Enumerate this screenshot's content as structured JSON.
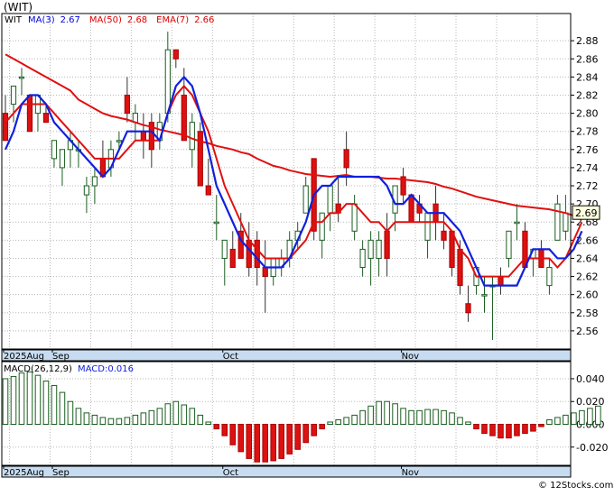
{
  "chart_data": [
    {
      "type": "candlestick",
      "symbol": "(WIT)",
      "legend": {
        "ticker": "WIT",
        "items": [
          {
            "label": "MA(3)",
            "value": "2.67",
            "color": "#0000dd"
          },
          {
            "label": "MA(50)",
            "value": "2.68",
            "color": "#dd0000"
          },
          {
            "label": "EMA(7)",
            "value": "2.66",
            "color": "#dd0000"
          }
        ]
      },
      "ylim": [
        2.54,
        2.91
      ],
      "y_ticks": [
        "2.88",
        "2.86",
        "2.84",
        "2.82",
        "2.80",
        "2.78",
        "2.76",
        "2.74",
        "2.72",
        "2.70",
        "2.68",
        "2.66",
        "2.64",
        "2.62",
        "2.60",
        "2.58",
        "2.56"
      ],
      "x_labels": [
        {
          "index": 0,
          "label": "2025Aug"
        },
        {
          "index": 6,
          "label": "Sep"
        },
        {
          "index": 27,
          "label": "Oct"
        },
        {
          "index": 49,
          "label": "Nov"
        }
      ],
      "last_price": "2.69",
      "candles": [
        {
          "o": 2.8,
          "h": 2.82,
          "l": 2.77,
          "c": 2.77
        },
        {
          "o": 2.81,
          "h": 2.83,
          "l": 2.79,
          "c": 2.83
        },
        {
          "o": 2.84,
          "h": 2.85,
          "l": 2.82,
          "c": 2.84
        },
        {
          "o": 2.82,
          "h": 2.82,
          "l": 2.78,
          "c": 2.78
        },
        {
          "o": 2.8,
          "h": 2.82,
          "l": 2.78,
          "c": 2.82
        },
        {
          "o": 2.8,
          "h": 2.81,
          "l": 2.79,
          "c": 2.79
        },
        {
          "o": 2.75,
          "h": 2.77,
          "l": 2.74,
          "c": 2.77
        },
        {
          "o": 2.74,
          "h": 2.76,
          "l": 2.72,
          "c": 2.76
        },
        {
          "o": 2.76,
          "h": 2.78,
          "l": 2.74,
          "c": 2.77
        },
        {
          "o": 2.76,
          "h": 2.77,
          "l": 2.74,
          "c": 2.76
        },
        {
          "o": 2.71,
          "h": 2.73,
          "l": 2.69,
          "c": 2.72
        },
        {
          "o": 2.72,
          "h": 2.74,
          "l": 2.7,
          "c": 2.73
        },
        {
          "o": 2.75,
          "h": 2.77,
          "l": 2.73,
          "c": 2.73
        },
        {
          "o": 2.74,
          "h": 2.77,
          "l": 2.73,
          "c": 2.76
        },
        {
          "o": 2.77,
          "h": 2.78,
          "l": 2.76,
          "c": 2.77
        },
        {
          "o": 2.82,
          "h": 2.84,
          "l": 2.79,
          "c": 2.8
        },
        {
          "o": 2.79,
          "h": 2.81,
          "l": 2.77,
          "c": 2.8
        },
        {
          "o": 2.78,
          "h": 2.8,
          "l": 2.75,
          "c": 2.77
        },
        {
          "o": 2.79,
          "h": 2.8,
          "l": 2.74,
          "c": 2.76
        },
        {
          "o": 2.77,
          "h": 2.8,
          "l": 2.76,
          "c": 2.79
        },
        {
          "o": 2.8,
          "h": 2.89,
          "l": 2.79,
          "c": 2.87
        },
        {
          "o": 2.87,
          "h": 2.87,
          "l": 2.85,
          "c": 2.86
        },
        {
          "o": 2.82,
          "h": 2.85,
          "l": 2.77,
          "c": 2.77
        },
        {
          "o": 2.76,
          "h": 2.8,
          "l": 2.74,
          "c": 2.79
        },
        {
          "o": 2.78,
          "h": 2.79,
          "l": 2.72,
          "c": 2.72
        },
        {
          "o": 2.72,
          "h": 2.75,
          "l": 2.71,
          "c": 2.71
        },
        {
          "o": 2.68,
          "h": 2.71,
          "l": 2.66,
          "c": 2.68
        },
        {
          "o": 2.64,
          "h": 2.66,
          "l": 2.61,
          "c": 2.66
        },
        {
          "o": 2.65,
          "h": 2.67,
          "l": 2.63,
          "c": 2.63
        },
        {
          "o": 2.67,
          "h": 2.69,
          "l": 2.64,
          "c": 2.64
        },
        {
          "o": 2.66,
          "h": 2.68,
          "l": 2.62,
          "c": 2.63
        },
        {
          "o": 2.66,
          "h": 2.67,
          "l": 2.61,
          "c": 2.63
        },
        {
          "o": 2.63,
          "h": 2.66,
          "l": 2.58,
          "c": 2.62
        },
        {
          "o": 2.62,
          "h": 2.64,
          "l": 2.61,
          "c": 2.64
        },
        {
          "o": 2.63,
          "h": 2.65,
          "l": 2.62,
          "c": 2.64
        },
        {
          "o": 2.64,
          "h": 2.67,
          "l": 2.63,
          "c": 2.66
        },
        {
          "o": 2.66,
          "h": 2.68,
          "l": 2.65,
          "c": 2.67
        },
        {
          "o": 2.69,
          "h": 2.73,
          "l": 2.69,
          "c": 2.72
        },
        {
          "o": 2.75,
          "h": 2.75,
          "l": 2.66,
          "c": 2.67
        },
        {
          "o": 2.66,
          "h": 2.68,
          "l": 2.64,
          "c": 2.69
        },
        {
          "o": 2.69,
          "h": 2.72,
          "l": 2.67,
          "c": 2.72
        },
        {
          "o": 2.7,
          "h": 2.73,
          "l": 2.68,
          "c": 2.69
        },
        {
          "o": 2.76,
          "h": 2.78,
          "l": 2.72,
          "c": 2.74
        },
        {
          "o": 2.67,
          "h": 2.71,
          "l": 2.66,
          "c": 2.7
        },
        {
          "o": 2.63,
          "h": 2.66,
          "l": 2.62,
          "c": 2.65
        },
        {
          "o": 2.64,
          "h": 2.67,
          "l": 2.61,
          "c": 2.66
        },
        {
          "o": 2.64,
          "h": 2.67,
          "l": 2.62,
          "c": 2.66
        },
        {
          "o": 2.67,
          "h": 2.69,
          "l": 2.62,
          "c": 2.64
        },
        {
          "o": 2.69,
          "h": 2.72,
          "l": 2.67,
          "c": 2.72
        },
        {
          "o": 2.73,
          "h": 2.74,
          "l": 2.7,
          "c": 2.71
        },
        {
          "o": 2.71,
          "h": 2.71,
          "l": 2.68,
          "c": 2.68
        },
        {
          "o": 2.7,
          "h": 2.71,
          "l": 2.68,
          "c": 2.69
        },
        {
          "o": 2.66,
          "h": 2.69,
          "l": 2.64,
          "c": 2.69
        },
        {
          "o": 2.7,
          "h": 2.72,
          "l": 2.66,
          "c": 2.68
        },
        {
          "o": 2.67,
          "h": 2.69,
          "l": 2.65,
          "c": 2.66
        },
        {
          "o": 2.67,
          "h": 2.67,
          "l": 2.62,
          "c": 2.63
        },
        {
          "o": 2.65,
          "h": 2.66,
          "l": 2.6,
          "c": 2.61
        },
        {
          "o": 2.59,
          "h": 2.61,
          "l": 2.57,
          "c": 2.58
        },
        {
          "o": 2.61,
          "h": 2.63,
          "l": 2.6,
          "c": 2.63
        },
        {
          "o": 2.6,
          "h": 2.62,
          "l": 2.58,
          "c": 2.6
        },
        {
          "o": 2.61,
          "h": 2.62,
          "l": 2.55,
          "c": 2.61
        },
        {
          "o": 2.62,
          "h": 2.63,
          "l": 2.6,
          "c": 2.61
        },
        {
          "o": 2.64,
          "h": 2.67,
          "l": 2.63,
          "c": 2.67
        },
        {
          "o": 2.68,
          "h": 2.7,
          "l": 2.66,
          "c": 2.68
        },
        {
          "o": 2.67,
          "h": 2.68,
          "l": 2.63,
          "c": 2.63
        },
        {
          "o": 2.64,
          "h": 2.65,
          "l": 2.62,
          "c": 2.65
        },
        {
          "o": 2.65,
          "h": 2.66,
          "l": 2.63,
          "c": 2.63
        },
        {
          "o": 2.61,
          "h": 2.64,
          "l": 2.6,
          "c": 2.63
        },
        {
          "o": 2.66,
          "h": 2.71,
          "l": 2.66,
          "c": 2.7
        },
        {
          "o": 2.67,
          "h": 2.71,
          "l": 2.66,
          "c": 2.69
        }
      ],
      "ma3": [
        2.76,
        2.78,
        2.81,
        2.82,
        2.82,
        2.81,
        2.79,
        2.78,
        2.77,
        2.76,
        2.75,
        2.74,
        2.73,
        2.74,
        2.76,
        2.78,
        2.78,
        2.78,
        2.78,
        2.77,
        2.8,
        2.83,
        2.84,
        2.83,
        2.8,
        2.76,
        2.72,
        2.7,
        2.68,
        2.66,
        2.65,
        2.64,
        2.63,
        2.63,
        2.63,
        2.64,
        2.66,
        2.68,
        2.71,
        2.72,
        2.72,
        2.73,
        2.73,
        2.73,
        2.73,
        2.73,
        2.73,
        2.72,
        2.7,
        2.7,
        2.71,
        2.7,
        2.69,
        2.69,
        2.69,
        2.68,
        2.67,
        2.65,
        2.63,
        2.61,
        2.61,
        2.61,
        2.61,
        2.61,
        2.63,
        2.65,
        2.65,
        2.65,
        2.64,
        2.64,
        2.65,
        2.67
      ],
      "ma50": [
        2.865,
        2.86,
        2.855,
        2.85,
        2.845,
        2.84,
        2.835,
        2.83,
        2.825,
        2.815,
        2.81,
        2.805,
        2.8,
        2.797,
        2.795,
        2.793,
        2.79,
        2.787,
        2.785,
        2.782,
        2.78,
        2.778,
        2.776,
        2.772,
        2.769,
        2.767,
        2.764,
        2.762,
        2.76,
        2.757,
        2.755,
        2.75,
        2.746,
        2.742,
        2.74,
        2.737,
        2.735,
        2.733,
        2.732,
        2.731,
        2.73,
        2.731,
        2.732,
        2.73,
        2.73,
        2.73,
        2.729,
        2.728,
        2.728,
        2.727,
        2.726,
        2.725,
        2.724,
        2.722,
        2.719,
        2.717,
        2.714,
        2.711,
        2.708,
        2.706,
        2.704,
        2.702,
        2.7,
        2.698,
        2.697,
        2.696,
        2.695,
        2.694,
        2.692,
        2.69,
        2.687,
        2.685
      ],
      "ema7": [
        2.79,
        2.8,
        2.81,
        2.81,
        2.81,
        2.81,
        2.8,
        2.79,
        2.78,
        2.77,
        2.76,
        2.75,
        2.75,
        2.75,
        2.75,
        2.76,
        2.77,
        2.77,
        2.77,
        2.77,
        2.8,
        2.82,
        2.83,
        2.82,
        2.8,
        2.78,
        2.75,
        2.72,
        2.7,
        2.68,
        2.66,
        2.65,
        2.64,
        2.64,
        2.64,
        2.64,
        2.65,
        2.66,
        2.68,
        2.68,
        2.69,
        2.69,
        2.7,
        2.7,
        2.69,
        2.68,
        2.68,
        2.67,
        2.68,
        2.68,
        2.68,
        2.68,
        2.68,
        2.68,
        2.68,
        2.67,
        2.65,
        2.64,
        2.62,
        2.62,
        2.62,
        2.62,
        2.62,
        2.63,
        2.64,
        2.64,
        2.64,
        2.64,
        2.63,
        2.64,
        2.66,
        2.68
      ]
    },
    {
      "type": "bar",
      "label": "MACD(26,12,9)",
      "value_label": "MACD:0.016",
      "ylim": [
        -0.036,
        0.055
      ],
      "y_ticks": [
        "0.040",
        "0.020",
        "0.000",
        "-0.020"
      ],
      "x_labels": [
        {
          "index": 0,
          "label": "2025Aug"
        },
        {
          "index": 6,
          "label": "Sep"
        },
        {
          "index": 27,
          "label": "Oct"
        },
        {
          "index": 49,
          "label": "Nov"
        }
      ],
      "values": [
        0.04,
        0.042,
        0.045,
        0.046,
        0.043,
        0.038,
        0.034,
        0.028,
        0.02,
        0.014,
        0.01,
        0.008,
        0.006,
        0.005,
        0.005,
        0.006,
        0.008,
        0.01,
        0.012,
        0.014,
        0.018,
        0.02,
        0.017,
        0.014,
        0.008,
        0.002,
        -0.004,
        -0.01,
        -0.018,
        -0.024,
        -0.03,
        -0.033,
        -0.033,
        -0.032,
        -0.03,
        -0.026,
        -0.022,
        -0.016,
        -0.01,
        -0.004,
        0.002,
        0.004,
        0.006,
        0.008,
        0.012,
        0.016,
        0.02,
        0.02,
        0.018,
        0.014,
        0.012,
        0.012,
        0.013,
        0.013,
        0.012,
        0.01,
        0.006,
        0.002,
        -0.004,
        -0.008,
        -0.01,
        -0.012,
        -0.012,
        -0.01,
        -0.008,
        -0.006,
        -0.002,
        0.004,
        0.006,
        0.008,
        0.01,
        0.012,
        0.014,
        0.016
      ]
    }
  ],
  "footer": {
    "credit": "© 12Stocks.com"
  }
}
